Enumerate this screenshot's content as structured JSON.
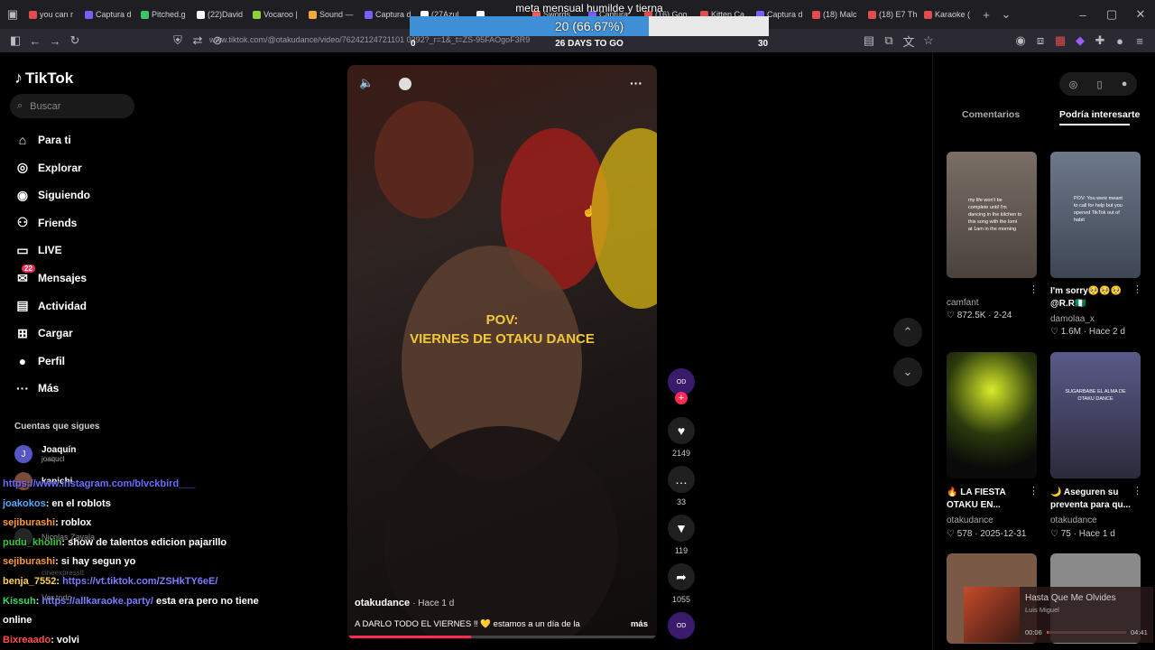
{
  "tabs": [
    {
      "label": "you can r",
      "color": "#e24c4c"
    },
    {
      "label": "Captura d",
      "color": "#7a5cff"
    },
    {
      "label": "Pitched.g",
      "color": "#3cc46b"
    },
    {
      "label": "(22)David",
      "color": "#ffffff"
    },
    {
      "label": "Vocaroo |",
      "color": "#8bd13b"
    },
    {
      "label": "Sound —",
      "color": "#f2a93b"
    },
    {
      "label": "Captura d",
      "color": "#7a5cff"
    },
    {
      "label": "(27Azul",
      "color": "#ffffff"
    },
    {
      "label": "",
      "color": "#ffffff"
    },
    {
      "label": "Swords",
      "color": "#ff5a5a"
    },
    {
      "label": "Captura",
      "color": "#7a5cff"
    },
    {
      "label": "(16) Goo",
      "color": "#e24c4c"
    },
    {
      "label": "Kitten Ca",
      "color": "#e24c4c"
    },
    {
      "label": "Captura d",
      "color": "#7a5cff"
    },
    {
      "label": "(18) Malc",
      "color": "#e24c4c"
    },
    {
      "label": "(18) E7 Th",
      "color": "#e24c4c"
    },
    {
      "label": "Karaoke (",
      "color": "#e24c4c"
    }
  ],
  "url": "www.tiktok.com/@otakudance/video/76242124721101 0292?_r=1&_t=ZS-95FAOgoF3R9",
  "goal": {
    "title": "meta mensual humilde y tierna",
    "percent_label": "20 (66.67%)",
    "fraction": 0.6667,
    "start": "0",
    "end": "30",
    "days": "26 DAYS TO GO"
  },
  "tiktok": {
    "logo": "TikTok",
    "search_placeholder": "Buscar",
    "nav": [
      {
        "label": "Para ti",
        "icon": "home-icon"
      },
      {
        "label": "Explorar",
        "icon": "compass-icon"
      },
      {
        "label": "Siguiendo",
        "icon": "following-icon"
      },
      {
        "label": "Friends",
        "icon": "friends-icon"
      },
      {
        "label": "LIVE",
        "icon": "live-icon"
      },
      {
        "label": "Mensajes",
        "icon": "message-icon",
        "badge": "22"
      },
      {
        "label": "Actividad",
        "icon": "activity-icon"
      },
      {
        "label": "Cargar",
        "icon": "upload-icon"
      },
      {
        "label": "Perfil",
        "icon": "profile-icon"
      },
      {
        "label": "Más",
        "icon": "more-icon"
      }
    ],
    "follows_title": "Cuentas que sigues",
    "accounts": [
      {
        "name": "Joaquín",
        "handle": "joaqucl",
        "initial": "J"
      },
      {
        "name": "kapichi",
        "handle": ""
      },
      {
        "name": "Nicolas Zavala",
        "handle": ""
      },
      {
        "name": "",
        "handle": "cineexpresstt"
      }
    ],
    "see_all": "Ver todo"
  },
  "chat": [
    {
      "user": "",
      "msg": "https://www.instagram.com/blvckbird___",
      "ucolor": "#6b6bff",
      "mcolor": "#6b6bff"
    },
    {
      "user": "joakokos",
      "msg": ": en el roblots",
      "ucolor": "#55aaff",
      "mcolor": "#ffffff"
    },
    {
      "user": "sejiburashi",
      "msg": ": roblox",
      "ucolor": "#ff9a3c",
      "mcolor": "#ffffff"
    },
    {
      "user": "pudu_kholin",
      "msg": ": show de talentos edicion pajarillo",
      "ucolor": "#3cc43c",
      "mcolor": "#ffffff"
    },
    {
      "user": "sejiburashi",
      "msg": ": si hay segun yo",
      "ucolor": "#ff9a3c",
      "mcolor": "#ffffff"
    },
    {
      "user": "benja_7552",
      "msg": ": ",
      "ucolor": "#ffd24c",
      "mcolor": "#ffffff",
      "link": "https://vt.tiktok.com/ZSHkTY6eE/"
    },
    {
      "user": "Kissuh",
      "msg": ": ",
      "ucolor": "#3cdc6b",
      "mcolor": "#ffffff",
      "link": "https://allkaraoke.party/",
      "tail": " esta era pero no tiene"
    },
    {
      "user": "",
      "msg": "online",
      "ucolor": "#ffffff",
      "mcolor": "#ffffff"
    },
    {
      "user": "Bixreaado",
      "msg": ": volvi",
      "ucolor": "#ff4c4c",
      "mcolor": "#ffffff"
    }
  ],
  "video": {
    "overlay_line1": "POV:",
    "overlay_line2": "VIERNES DE OTAKU DANCE",
    "author": "otakudance",
    "age": "· Hace 1 d",
    "caption": "A DARLO TODO EL VIERNES ‼ 💛 estamos a un día de la",
    "more": "más",
    "likes": "2149",
    "comments": "33",
    "saves": "119",
    "shares": "1055"
  },
  "right": {
    "tab_comments": "Comentarios",
    "tab_suggest": "Podría interesarte",
    "items": [
      {
        "title": "",
        "user": "camfant",
        "stats": "♡ 872.5K · 2-24"
      },
      {
        "title": "I'm sorry🥺🥺🥺 @R.R🇳🇬",
        "user": "damolaa_x",
        "stats": "♡ 1.6M · Hace 2 d"
      },
      {
        "title": "🔥 LA FIESTA OTAKU EN...",
        "user": "otakudance",
        "stats": "♡ 578 · 2025-12-31"
      },
      {
        "title": "🌙 Aseguren su preventa para qu...",
        "user": "otakudance",
        "stats": "♡ 75 · Hace 1 d"
      }
    ],
    "thumb1_text": "my life won't be complete until I'm dancing in the kitchen to this song with the lomi at 1am in the morning",
    "thumb2_text": "POV: You were meant to call for help but you opened TikTok out of habit",
    "thumb4_text": "SUGARBABE EL ALMA DE OTAKU DANCE"
  },
  "player": {
    "song": "Hasta Que Me Olvides",
    "artist": "Luis Miguel",
    "t1": "00:06",
    "t2": "04:41",
    "progress": 0.02
  }
}
